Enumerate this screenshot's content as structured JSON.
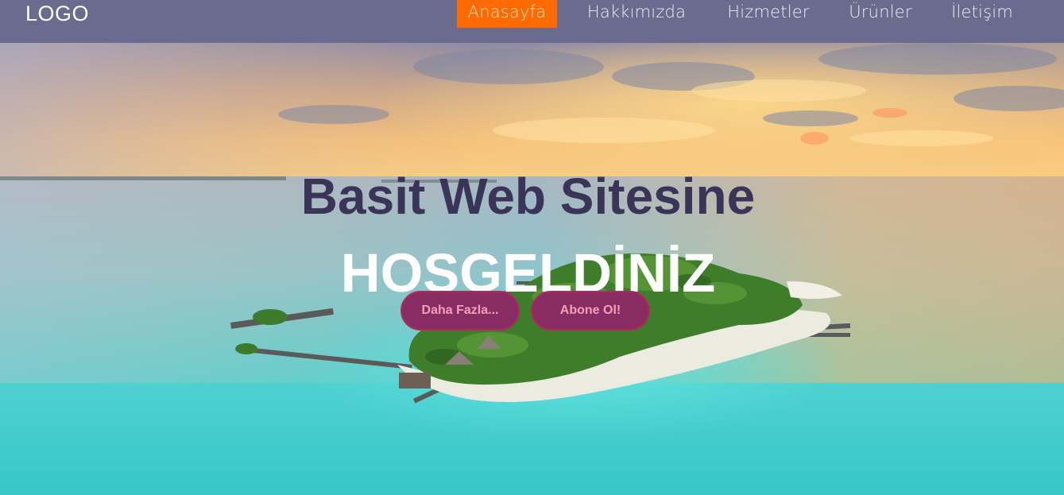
{
  "nav": {
    "logo": "LOGO",
    "links": [
      {
        "label": "Anasayfa",
        "active": true
      },
      {
        "label": "Hakkımızda",
        "active": false
      },
      {
        "label": "Hizmetler",
        "active": false
      },
      {
        "label": "Ürünler",
        "active": false
      },
      {
        "label": "İletişim",
        "active": false
      }
    ]
  },
  "hero": {
    "title_line1": "Basit Web Sitesine",
    "title_line2": "HOŞGELDİNİZ",
    "buttons": {
      "more": "Daha Fazla...",
      "subscribe": "Abone Ol!"
    },
    "background": "aerial-island-sunset-photo"
  },
  "colors": {
    "navbar": "#6b6b8f",
    "active_link": "#ff6a00",
    "title_dark": "#3a3558",
    "button_bg": "#8a2c64",
    "button_text": "#f2a0b8"
  }
}
